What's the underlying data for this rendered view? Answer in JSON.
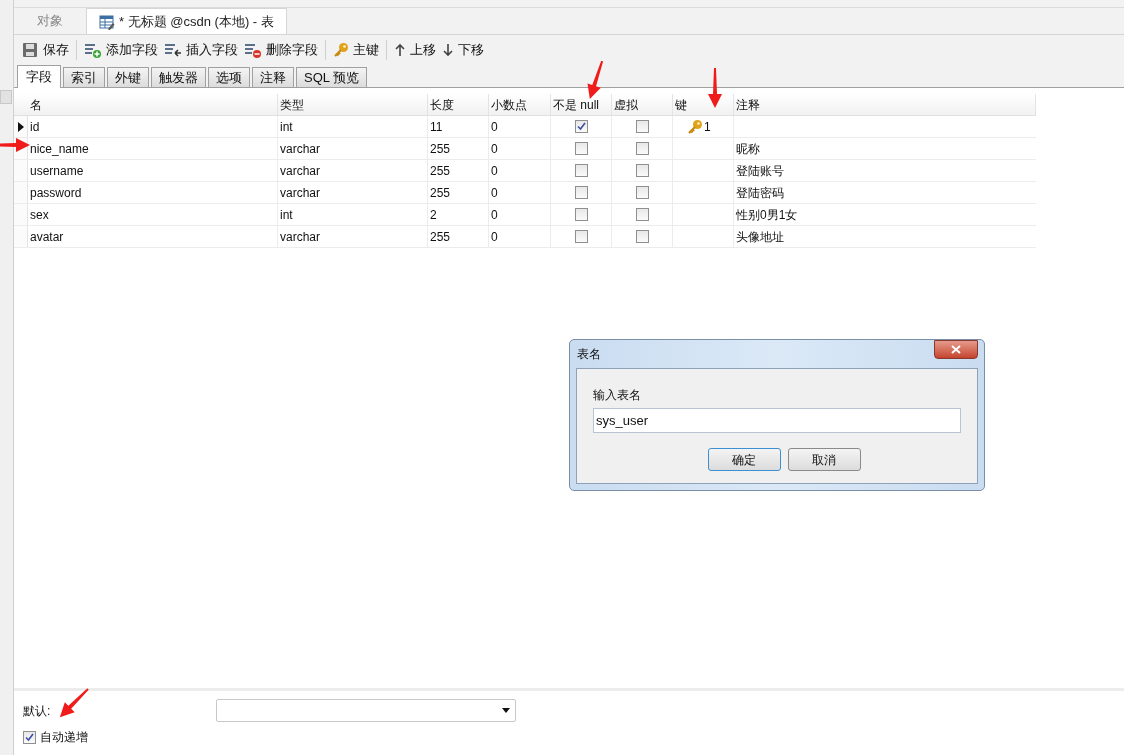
{
  "document_tabs": [
    {
      "label": "对象",
      "selected": false
    },
    {
      "label": "* 无标题 @csdn (本地) - 表",
      "selected": true
    }
  ],
  "toolbar": [
    {
      "kind": "save",
      "label": "保存"
    },
    {
      "kind": "add",
      "label": "添加字段"
    },
    {
      "kind": "insert",
      "label": "插入字段"
    },
    {
      "kind": "delete",
      "label": "删除字段"
    },
    {
      "kind": "key",
      "label": "主键"
    },
    {
      "kind": "up",
      "label": "上移"
    },
    {
      "kind": "down",
      "label": "下移"
    }
  ],
  "editor_tabs": [
    {
      "label": "字段",
      "selected": true
    },
    {
      "label": "索引",
      "selected": false
    },
    {
      "label": "外键",
      "selected": false
    },
    {
      "label": "触发器",
      "selected": false
    },
    {
      "label": "选项",
      "selected": false
    },
    {
      "label": "注释",
      "selected": false
    },
    {
      "label": "SQL 预览",
      "selected": false
    }
  ],
  "table": {
    "columns": [
      "名",
      "类型",
      "长度",
      "小数点",
      "不是 null",
      "虚拟",
      "键",
      "注释"
    ],
    "rows": [
      {
        "selected": true,
        "name": "id",
        "type": "int",
        "length": "11",
        "decimals": "0",
        "not_null": true,
        "virtual": false,
        "key": "1",
        "comment": ""
      },
      {
        "selected": false,
        "name": "nice_name",
        "type": "varchar",
        "length": "255",
        "decimals": "0",
        "not_null": false,
        "virtual": false,
        "comment": "昵称"
      },
      {
        "selected": false,
        "name": "username",
        "type": "varchar",
        "length": "255",
        "decimals": "0",
        "not_null": false,
        "virtual": false,
        "comment": "登陆账号"
      },
      {
        "selected": false,
        "name": "password",
        "type": "varchar",
        "length": "255",
        "decimals": "0",
        "not_null": false,
        "virtual": false,
        "comment": "登陆密码"
      },
      {
        "selected": false,
        "name": "sex",
        "type": "int",
        "length": "2",
        "decimals": "0",
        "not_null": false,
        "virtual": false,
        "comment": "性别0男1女"
      },
      {
        "selected": false,
        "name": "avatar",
        "type": "varchar",
        "length": "255",
        "decimals": "0",
        "not_null": false,
        "virtual": false,
        "comment": "头像地址"
      }
    ]
  },
  "properties": {
    "default_label": "默认:",
    "auto_increment": {
      "label": "自动递增",
      "checked": true
    }
  },
  "dialog": {
    "title": "表名",
    "label": "输入表名",
    "value": "sys_user",
    "buttons": [
      {
        "label": "确定",
        "default": true
      },
      {
        "label": "取消",
        "default": false
      }
    ]
  }
}
